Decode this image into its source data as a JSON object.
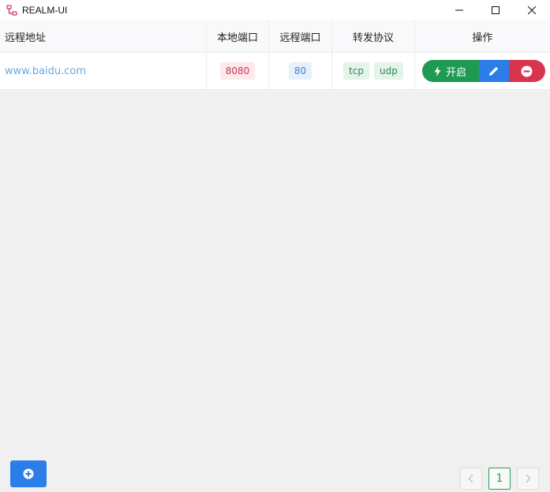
{
  "window": {
    "title": "REALM-UI"
  },
  "table": {
    "headers": {
      "remote_address": "远程地址",
      "local_port": "本地端口",
      "remote_port": "远程端口",
      "protocol": "转发协议",
      "actions": "操作"
    },
    "rows": [
      {
        "remote_address": "www.baidu.com",
        "local_port": "8080",
        "remote_port": "80",
        "protocols": [
          "tcp",
          "udp"
        ],
        "start_label": "开启"
      }
    ]
  },
  "pagination": {
    "current_page": "1"
  },
  "colors": {
    "primary": "#2b7de9",
    "success": "#1f9a52",
    "danger": "#d9344d",
    "link": "#6aa9e0"
  }
}
